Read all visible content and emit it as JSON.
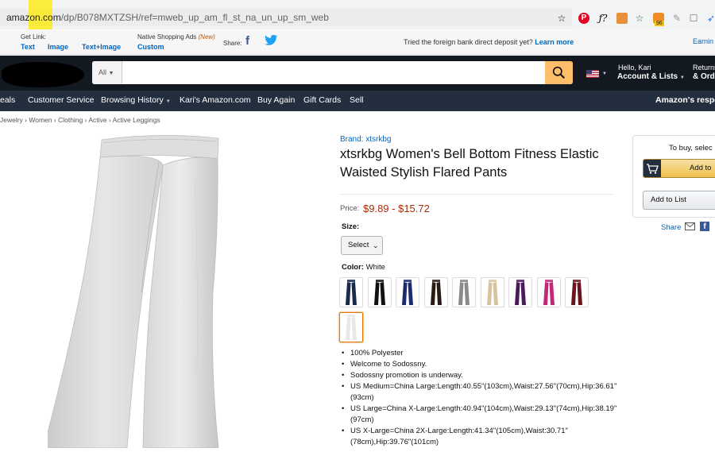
{
  "browser": {
    "url_host": "amazon.com",
    "url_path": "/dp/B078MXTZSH/ref=mweb_up_am_fl_st_na_un_up_sm_web",
    "extension_badge": "96"
  },
  "sitestripe": {
    "get_link_label": "Get Link:",
    "link_text": "Text",
    "link_image": "Image",
    "link_text_image": "Text+Image",
    "native_ads_label": "Native Shopping Ads",
    "native_ads_new": "(New)",
    "custom_link": "Custom",
    "share_label": "Share:",
    "promo_text": "Tried the foreign bank direct deposit yet?",
    "learn_more": "Learn more",
    "earnings": "Earnin"
  },
  "header": {
    "search_department": "All",
    "greeting": "Hello, Kari",
    "account_lists": "Account & Lists",
    "returns_small": "Returns",
    "returns_orders": "& Ord"
  },
  "nav": {
    "items": [
      "eals",
      "Customer Service",
      "Browsing History",
      "Kari's Amazon.com",
      "Buy Again",
      "Gift Cards",
      "Sell"
    ],
    "right_text": "Amazon's respo"
  },
  "breadcrumb": {
    "items": [
      "Jewelry",
      "Women",
      "Clothing",
      "Active",
      "Active Leggings"
    ]
  },
  "product": {
    "brand": "Brand: xtsrkbg",
    "title": "xtsrkbg Women's Bell Bottom Fitness Elastic Waisted Stylish Flared Pants",
    "price_label": "Price:",
    "price": "$9.89 - $15.72",
    "size_label": "Size:",
    "size_select": "Select",
    "color_label": "Color:",
    "color_value": "White",
    "swatch_colors": [
      "#1a2a4a",
      "#111111",
      "#1d2a6b",
      "#2a1a14",
      "#8a8a8a",
      "#d8c3a0",
      "#4a1a5a",
      "#c0287a",
      "#6a1420",
      "#e8e8e8"
    ],
    "bullets": [
      "100% Polyester",
      "Welcome to Sodossny.",
      "Sodossny promotion is underway.",
      "US Medium=China Large:Length:40.55\"(103cm),Waist:27.56\"(70cm),Hip:36.61\"(93cm)",
      "US Large=China X-Large:Length:40.94\"(104cm),Waist:29.13\"(74cm),Hip:38.19\"(97cm)",
      "US X-Large=China 2X-Large:Length:41.34\"(105cm),Waist:30.71\"(78cm),Hip:39.76\"(101cm)"
    ]
  },
  "buybox": {
    "to_buy_text": "To buy, selec",
    "add_to_cart": "Add to",
    "add_to_list": "Add to List",
    "share": "Share"
  },
  "colors": {
    "header_bg": "#131921",
    "nav_bg": "#232f3e",
    "search_button": "#febd69",
    "price": "#b12704",
    "link": "#0066c0"
  }
}
